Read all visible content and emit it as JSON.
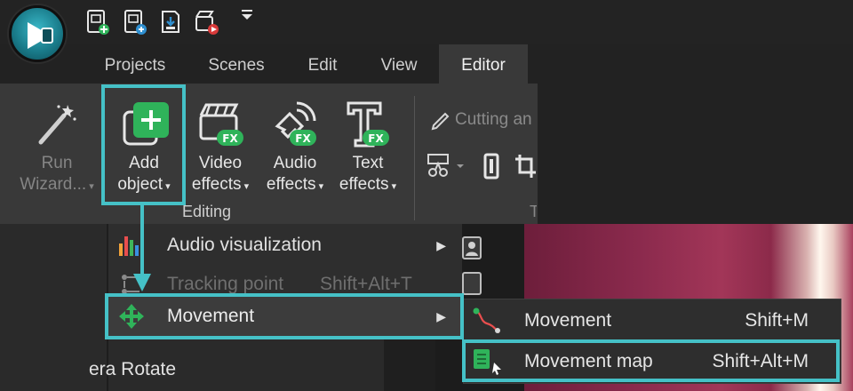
{
  "menu_tabs": [
    {
      "label": "Projects",
      "active": false
    },
    {
      "label": "Scenes",
      "active": false
    },
    {
      "label": "Edit",
      "active": false
    },
    {
      "label": "View",
      "active": false
    },
    {
      "label": "Editor",
      "active": true
    }
  ],
  "ribbon": {
    "run_wizard": {
      "line1": "Run",
      "line2": "Wizard..."
    },
    "add_object": {
      "line1": "Add",
      "line2": "object"
    },
    "video_effects": {
      "line1": "Video",
      "line2": "effects"
    },
    "audio_effects": {
      "line1": "Audio",
      "line2": "effects"
    },
    "text_effects": {
      "line1": "Text",
      "line2": "effects"
    },
    "fx_badge": "FX",
    "group_label": "Editing",
    "cutting_label": "Cutting an",
    "group_label_2": "T"
  },
  "add_object_menu": [
    {
      "label": "Audio visualization",
      "shortcut": "",
      "has_submenu": true,
      "state": "normal",
      "icon": "equalizer-icon"
    },
    {
      "label": "Tracking point",
      "shortcut": "Shift+Alt+T",
      "has_submenu": false,
      "state": "disabled",
      "icon": "tracking-point-icon"
    },
    {
      "label": "Movement",
      "shortcut": "",
      "has_submenu": true,
      "state": "selected",
      "icon": "move-arrows-icon"
    }
  ],
  "movement_submenu": [
    {
      "label": "Movement",
      "shortcut": "Shift+M",
      "icon": "movement-path-icon"
    },
    {
      "label": "Movement map",
      "shortcut": "Shift+Alt+M",
      "icon": "movement-map-icon"
    }
  ],
  "background_items": [
    "era Rotate"
  ],
  "colors": {
    "highlight": "#45c1c7",
    "ribbon_bg": "#393939",
    "menu_bg": "#2e2e2e",
    "fx_green": "#2fb35a"
  }
}
